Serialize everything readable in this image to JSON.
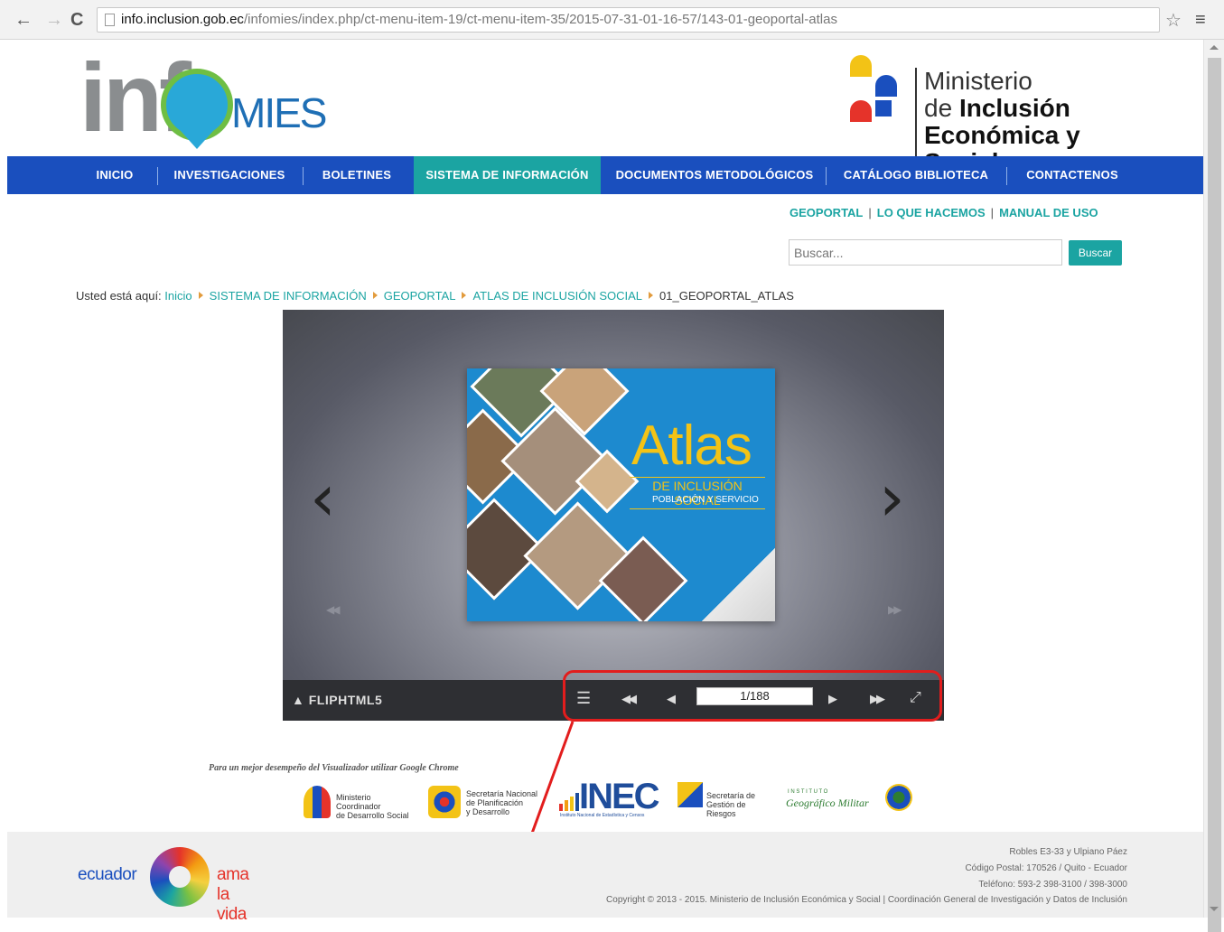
{
  "browser": {
    "back_icon": "arrow-left-icon",
    "forward_icon": "arrow-right-icon",
    "reload_icon": "reload-icon",
    "url_host": "info.inclusion.gob.ec",
    "url_path": "/infomies/index.php/ct-menu-item-19/ct-menu-item-35/2015-07-31-01-16-57/143-01-geoportal-atlas"
  },
  "header": {
    "logo_left_info": "inf",
    "logo_left_mies": "MIES",
    "logo_right_line1": "Ministerio",
    "logo_right_line2_a": "de ",
    "logo_right_line2_b": "Inclusión",
    "logo_right_line3": "Económica y Social"
  },
  "nav": {
    "items": [
      {
        "label": "INICIO"
      },
      {
        "label": "INVESTIGACIONES"
      },
      {
        "label": "BOLETINES"
      },
      {
        "label": "SISTEMA DE INFORMACIÓN"
      },
      {
        "label": "DOCUMENTOS METODOLÓGICOS"
      },
      {
        "label": "CATÁLOGO BIBLIOTECA"
      },
      {
        "label": "CONTACTENOS"
      }
    ],
    "active_index": 3
  },
  "sublinks": {
    "items": [
      {
        "label": "GEOPORTAL"
      },
      {
        "label": "LO QUE HACEMOS"
      },
      {
        "label": "MANUAL DE USO"
      }
    ],
    "separator": "|"
  },
  "search": {
    "placeholder": "Buscar...",
    "button_label": "Buscar"
  },
  "breadcrumb": {
    "prefix": "Usted está aquí:",
    "items": [
      {
        "label": "Inicio"
      },
      {
        "label": "SISTEMA DE INFORMACIÓN"
      },
      {
        "label": "GEOPORTAL"
      },
      {
        "label": "ATLAS DE INCLUSIÓN SOCIAL"
      }
    ],
    "current": "01_GEOPORTAL_ATLAS"
  },
  "viewer": {
    "book_title": "Atlas",
    "book_subtitle": "DE INCLUSIÓN SOCIAL",
    "book_subtitle2": "POBLACIÓN Y SERVICIO",
    "brand": "FLIPHTML5",
    "page_indicator": "1/188",
    "prev_arrow": "‹",
    "next_arrow": "›"
  },
  "note": {
    "chrome_text": "Para un mejor desempeño del Visualizador utilizar Google Chrome"
  },
  "partners": {
    "p1_line1": "Ministerio Coordinador",
    "p1_line2": "de Desarrollo Social",
    "p2_line1": "Secretaría Nacional",
    "p2_line2": "de Planificación",
    "p2_line3": "y Desarrollo",
    "p3_word": "INEC",
    "p3_tag": "Instituto Nacional de Estadística y Censos",
    "p4_line1": "Secretaría de",
    "p4_line2": "Gestión de Riesgos",
    "p5_line1": "I N S T I T U T O",
    "p5_line2": "Geográfico Militar"
  },
  "footer": {
    "slogan_left": "ecuador",
    "slogan_right": "ama la vida",
    "address1": "Robles E3-33 y Ulpiano Páez",
    "address2": "Código Postal: 170526 / Quito - Ecuador",
    "address3": "Teléfono: 593-2 398-3100 / 398-3000",
    "copyright": "Copyright © 2013 - 2015. Ministerio de Inclusión Económica y Social | Coordinación General de Investigación y Datos de Inclusión"
  },
  "colors": {
    "nav_blue": "#1a4fbe",
    "accent_teal": "#1ba4a2",
    "annotation_red": "#e21d1d"
  }
}
